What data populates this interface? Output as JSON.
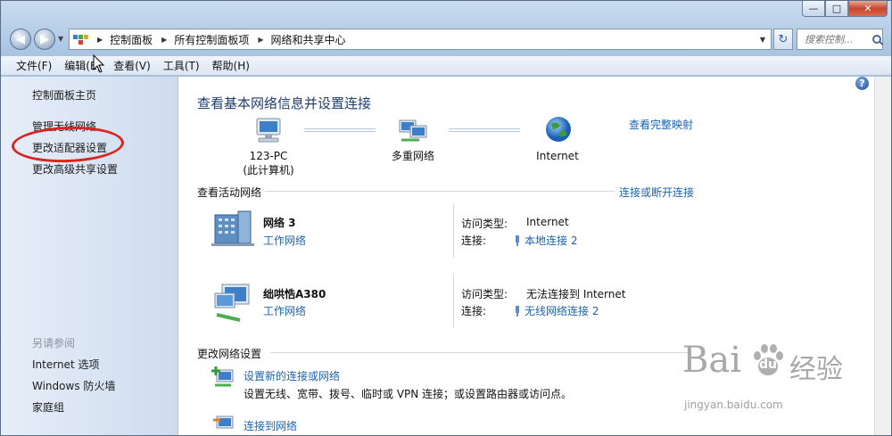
{
  "window": {
    "min_icon": "minimize-icon",
    "max_icon": "maximize-icon",
    "close_icon": "close-icon"
  },
  "address": {
    "crumbs": [
      "控制面板",
      "所有控制面板项",
      "网络和共享中心"
    ],
    "search_placeholder": "搜索控制..."
  },
  "menu": [
    "文件(F)",
    "编辑(E)",
    "查看(V)",
    "工具(T)",
    "帮助(H)"
  ],
  "sidebar": {
    "home": "控制面板主页",
    "links": [
      "管理无线网络",
      "更改适配器设置",
      "更改高级共享设置"
    ],
    "see_also_head": "另请参阅",
    "see_also": [
      "Internet 选项",
      "Windows 防火墙",
      "家庭组"
    ]
  },
  "main": {
    "title": "查看基本网络信息并设置连接",
    "full_map_link": "查看完整映射",
    "map": {
      "pc_name": "123-PC",
      "pc_sub": "(此计算机)",
      "middle": "多重网络",
      "internet": "Internet"
    },
    "active_head": "查看活动网络",
    "connect_link": "连接或断开连接",
    "networks": [
      {
        "name": "网络  3",
        "type": "工作网络",
        "access_label": "访问类型:",
        "access": "Internet",
        "conn_label": "连接:",
        "conn": "本地连接 2"
      },
      {
        "name": "绌哄悎A380",
        "type": "工作网络",
        "access_label": "访问类型:",
        "access": "无法连接到 Internet",
        "conn_label": "连接:",
        "conn": "无线网络连接 2"
      }
    ],
    "change_head": "更改网络设置",
    "tasks": [
      {
        "link": "设置新的连接或网络",
        "desc": "设置无线、宽带、拨号、临时或 VPN 连接；或设置路由器或访问点。"
      },
      {
        "link": "连接到网络",
        "desc": ""
      }
    ]
  },
  "watermark": {
    "brand": "Bai",
    "brand2": "du",
    "cn": "经验",
    "url": "jingyan.baidu.com"
  }
}
